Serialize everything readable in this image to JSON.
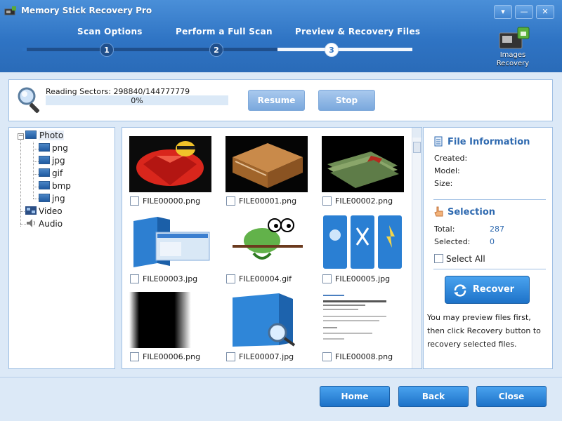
{
  "app": {
    "title": "Memory Stick Recovery Pro"
  },
  "window_controls": {
    "menu": "▾",
    "minimize": "—",
    "close": "✕"
  },
  "steps": [
    {
      "number": "1",
      "label": "Scan Options"
    },
    {
      "number": "2",
      "label": "Perform a Full Scan"
    },
    {
      "number": "3",
      "label": "Preview & Recovery Files"
    }
  ],
  "badge": {
    "line1": "Images",
    "line2": "Recovery"
  },
  "scan": {
    "status": "Reading Sectors: 298840/144777779",
    "progress_text": "0%",
    "progress_value": 0,
    "resume_label": "Resume",
    "stop_label": "Stop"
  },
  "tree": {
    "photo": "Photo",
    "children": [
      "png",
      "jpg",
      "gif",
      "bmp",
      "jng"
    ],
    "video": "Video",
    "audio": "Audio"
  },
  "thumbnails": [
    {
      "name": "FILE00000.png"
    },
    {
      "name": "FILE00001.png"
    },
    {
      "name": "FILE00002.png"
    },
    {
      "name": "FILE00003.jpg"
    },
    {
      "name": "FILE00004.gif"
    },
    {
      "name": "FILE00005.jpg"
    },
    {
      "name": "FILE00006.png"
    },
    {
      "name": "FILE00007.jpg"
    },
    {
      "name": "FILE00008.png"
    }
  ],
  "file_info": {
    "title": "File Information",
    "created": "Created:",
    "model": "Model:",
    "size": "Size:"
  },
  "selection": {
    "title": "Selection",
    "total_label": "Total:",
    "total_value": "287",
    "selected_label": "Selected:",
    "selected_value": "0",
    "select_all": "Select All"
  },
  "recover": {
    "button": "Recover",
    "hint": "You may preview files first, then click Recovery button to recovery selected files."
  },
  "footer": {
    "home": "Home",
    "back": "Back",
    "close": "Close"
  },
  "colors": {
    "accent": "#2f74c4",
    "link": "#2f6ab0",
    "panel_border": "#9fbfe3"
  }
}
